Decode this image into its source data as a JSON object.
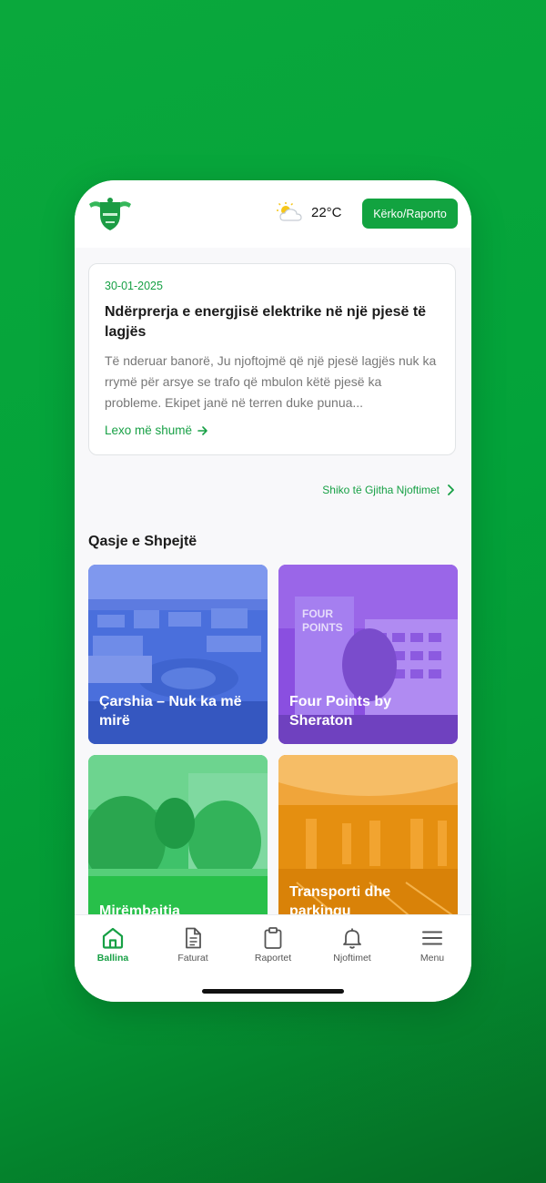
{
  "header": {
    "logo_alt": "Municipality crest",
    "weather": {
      "icon": "partly-cloudy-icon",
      "temperature": "22°C"
    },
    "action_button": "Kërko/Raporto"
  },
  "news": {
    "date": "30-01-2025",
    "title": "Ndërprerja e energjisë elektrike në një pjesë të lagjës",
    "body": "Të nderuar banorë, Ju njoftojmë që një pjesë lagjës nuk ka rrymë për arsye se trafo që mbulon këtë pjesë ka probleme. Ekipet janë në terren duke punua...",
    "read_more": "Lexo më shumë"
  },
  "see_all": "Shiko të Gjitha Njoftimet",
  "quick_access": {
    "title": "Qasje e Shpejtë",
    "tiles": [
      {
        "label": "Çarshia – Nuk ka më mirë"
      },
      {
        "label": "Four Points by Sheraton"
      },
      {
        "label": "Mirëmbajtja"
      },
      {
        "label": "Transporti dhe parkingu"
      }
    ]
  },
  "tabbar": {
    "items": [
      {
        "label": "Ballina",
        "icon": "home-icon",
        "active": true
      },
      {
        "label": "Faturat",
        "icon": "document-icon"
      },
      {
        "label": "Raportet",
        "icon": "clipboard-icon"
      },
      {
        "label": "Njoftimet",
        "icon": "bell-icon"
      },
      {
        "label": "Menu",
        "icon": "menu-icon"
      }
    ]
  },
  "colors": {
    "accent": "#12a340",
    "background": "#03a33a"
  }
}
